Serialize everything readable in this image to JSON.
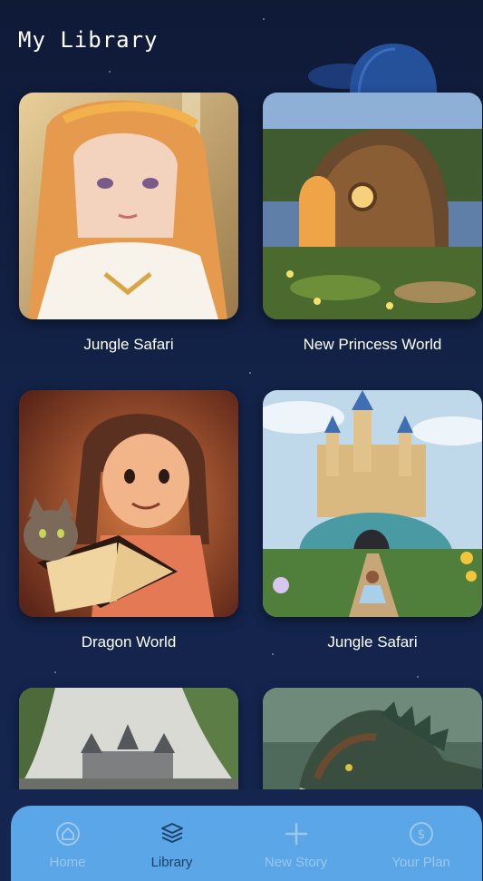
{
  "header": {
    "title": "My Library"
  },
  "library": {
    "items": [
      {
        "title": "Jungle Safari",
        "art": "princess-portrait"
      },
      {
        "title": "New Princess World",
        "art": "hobbit-house"
      },
      {
        "title": "Dragon World",
        "art": "girl-reading-with-cat"
      },
      {
        "title": "Jungle Safari",
        "art": "fairytale-castle"
      },
      {
        "title": "",
        "art": "castle-in-forest"
      },
      {
        "title": "",
        "art": "dragon"
      }
    ]
  },
  "bottom_nav": {
    "active": "Library",
    "items": [
      {
        "label": "Home",
        "icon": "home-icon"
      },
      {
        "label": "Library",
        "icon": "library-stack-icon"
      },
      {
        "label": "New Story",
        "icon": "plus-icon"
      },
      {
        "label": "Your Plan",
        "icon": "dollar-circle-icon"
      }
    ]
  },
  "colors": {
    "background": "#132248",
    "nav_bar": "#5aa6e6",
    "nav_active": "#1e3f66",
    "nav_inactive": "#9ac8ef",
    "text": "#ffffff"
  }
}
